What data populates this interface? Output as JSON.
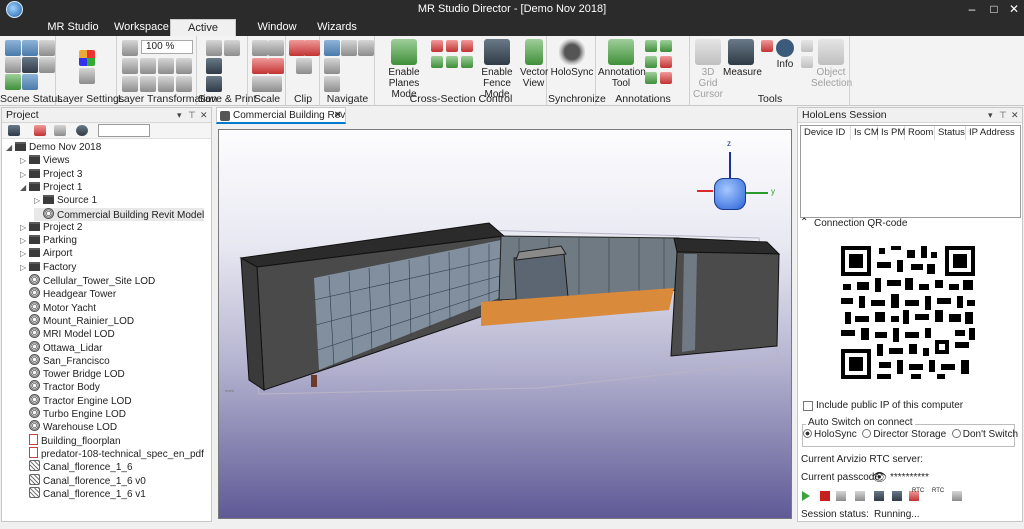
{
  "window": {
    "title": "MR Studio Director - [Demo Nov 2018]"
  },
  "menu": {
    "tabs": [
      "MR Studio Admin",
      "Workspace",
      "Active Scene",
      "Window Layout",
      "Wizards"
    ],
    "active": "Active Scene"
  },
  "ribbon": {
    "groups": [
      "Scene Status",
      "Layer Settings",
      "Layer Transformation",
      "Save & Print",
      "Scale",
      "Clip",
      "Navigate",
      "Cross-Section Control",
      "Synchronize",
      "Annotations",
      "Tools"
    ],
    "zoom_value": "100 %",
    "buttons": {
      "enable_planes_mode": "Enable Planes Mode",
      "enable_fence_mode": "Enable Fence Mode",
      "vector_view": "Vector View",
      "holosync": "HoloSync",
      "annotation_tool": "Annotation Tool",
      "grid_cursor": "3D Grid Cursor",
      "measure": "Measure",
      "info": "Info",
      "object_selection": "Object Selection"
    }
  },
  "project": {
    "title": "Project",
    "tree": [
      {
        "label": "Demo Nov 2018",
        "level": 0,
        "arrow": "◢",
        "icon": "folder"
      },
      {
        "label": "Views",
        "level": 1,
        "arrow": "▷",
        "icon": "folder"
      },
      {
        "label": "Project 3",
        "level": 1,
        "arrow": "▷",
        "icon": "folder"
      },
      {
        "label": "Project 1",
        "level": 1,
        "arrow": "◢",
        "icon": "folder"
      },
      {
        "label": "Source 1",
        "level": 2,
        "arrow": "▷",
        "icon": "folder"
      },
      {
        "label": "Commercial Building Revit Model",
        "level": 2,
        "arrow": "",
        "icon": "model"
      },
      {
        "label": "Project 2",
        "level": 1,
        "arrow": "▷",
        "icon": "folder"
      },
      {
        "label": "Parking",
        "level": 1,
        "arrow": "▷",
        "icon": "folder"
      },
      {
        "label": "Airport",
        "level": 1,
        "arrow": "▷",
        "icon": "folder"
      },
      {
        "label": "Factory",
        "level": 1,
        "arrow": "▷",
        "icon": "folder"
      },
      {
        "label": "Cellular_Tower_Site LOD",
        "level": 1,
        "arrow": "",
        "icon": "model"
      },
      {
        "label": "Headgear Tower",
        "level": 1,
        "arrow": "",
        "icon": "model"
      },
      {
        "label": "Motor Yacht",
        "level": 1,
        "arrow": "",
        "icon": "model"
      },
      {
        "label": "Mount_Rainier_LOD",
        "level": 1,
        "arrow": "",
        "icon": "model"
      },
      {
        "label": "MRI Model LOD",
        "level": 1,
        "arrow": "",
        "icon": "model"
      },
      {
        "label": "Ottawa_Lidar",
        "level": 1,
        "arrow": "",
        "icon": "model"
      },
      {
        "label": "San_Francisco",
        "level": 1,
        "arrow": "",
        "icon": "model"
      },
      {
        "label": "Tower Bridge LOD",
        "level": 1,
        "arrow": "",
        "icon": "model"
      },
      {
        "label": "Tractor Body",
        "level": 1,
        "arrow": "",
        "icon": "model"
      },
      {
        "label": "Tractor Engine LOD",
        "level": 1,
        "arrow": "",
        "icon": "model"
      },
      {
        "label": "Turbo Engine LOD",
        "level": 1,
        "arrow": "",
        "icon": "model"
      },
      {
        "label": "Warehouse LOD",
        "level": 1,
        "arrow": "",
        "icon": "model"
      },
      {
        "label": "Building_floorplan",
        "level": 1,
        "arrow": "",
        "icon": "doc"
      },
      {
        "label": "predator-108-technical_spec_en_pdf",
        "level": 1,
        "arrow": "",
        "icon": "doc"
      },
      {
        "label": "Canal_florence_1_6",
        "level": 1,
        "arrow": "",
        "icon": "mesh"
      },
      {
        "label": "Canal_florence_1_6 v0",
        "level": 1,
        "arrow": "",
        "icon": "mesh"
      },
      {
        "label": "Canal_florence_1_6 v1",
        "level": 1,
        "arrow": "",
        "icon": "mesh"
      }
    ]
  },
  "viewport": {
    "tab_label": "Commercial Building Revi...",
    "axis_labels": {
      "z": "z",
      "y": "y"
    }
  },
  "holo": {
    "title": "HoloLens Session",
    "columns": [
      "Device ID",
      "Is CM",
      "Is PM",
      "Room",
      "Status",
      "IP Address"
    ],
    "qr_label": "Connection QR-code",
    "include_public_ip": "Include public IP of this computer",
    "auto_switch": {
      "title": "Auto Switch on connect",
      "options": [
        "HoloSync",
        "Director Storage",
        "Don't Switch"
      ],
      "selected": "HoloSync"
    },
    "rtc_server_label": "Current Arvizio RTC server:",
    "passcode_label": "Current passcode:",
    "passcode_value": "**********",
    "session_status_label": "Session status:",
    "session_status_value": "Running...",
    "rtc_small_1": "RTC",
    "rtc_small_2": "RTC"
  }
}
